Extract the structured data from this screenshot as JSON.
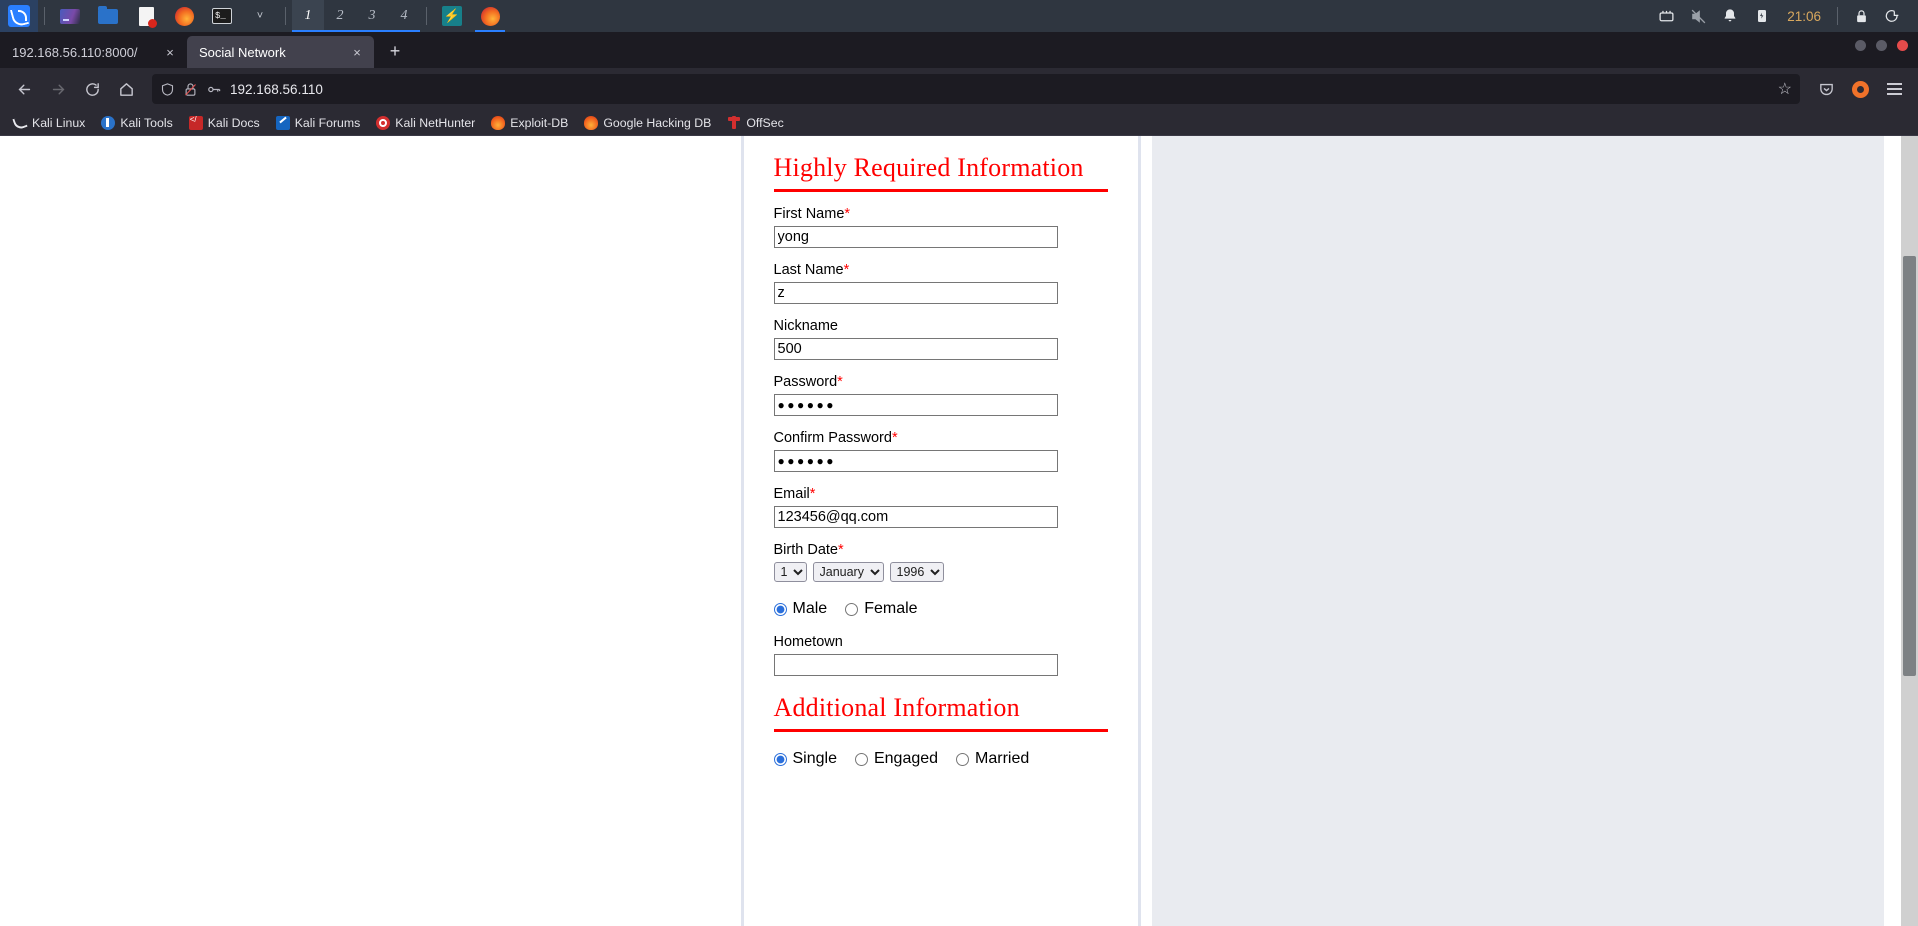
{
  "taskbar": {
    "apps": [
      {
        "name": "kali-menu-icon",
        "label": "Kali Linux Menu"
      },
      {
        "name": "workspace-switcher-icon",
        "label": "Workspace Switcher"
      },
      {
        "name": "file-manager-icon",
        "label": "Files"
      },
      {
        "name": "text-editor-icon",
        "label": "Text Editor"
      },
      {
        "name": "firefox-icon",
        "label": "Firefox"
      },
      {
        "name": "terminal-icon",
        "label": "Terminal"
      }
    ],
    "terminal_glyph": "$_",
    "dropdown_chevron": "˅",
    "workspaces": [
      "1",
      "2",
      "3",
      "4"
    ],
    "active_workspace": "1",
    "running": [
      {
        "name": "zap-icon",
        "glyph": "⚡"
      },
      {
        "name": "firefox-window-icon",
        "glyph": ""
      }
    ],
    "tray": {
      "network_icon": "network-icon",
      "volume_muted_icon": "volume-muted-icon",
      "notifications_icon": "bell-icon",
      "battery_icon": "battery-icon",
      "clock": "21:06",
      "lock_icon": "lock-icon",
      "logout_icon": "logout-icon"
    }
  },
  "browser": {
    "tabs": [
      {
        "title": "192.168.56.110:8000/",
        "active": false,
        "close": "×"
      },
      {
        "title": "Social Network",
        "active": true,
        "close": "×"
      }
    ],
    "new_tab_glyph": "+",
    "window_controls": [
      "minimize",
      "maximize",
      "close"
    ],
    "nav": {
      "back": "←",
      "forward": "→",
      "reload": "⟳",
      "home": "⌂"
    },
    "urlbar": {
      "shield_icon": "shield-icon",
      "insecure_lock_icon": "lock-crossed-icon",
      "key_icon": "key-icon",
      "url": "192.168.56.110",
      "bookmark_star": "☆"
    },
    "toolbar_right": {
      "pocket_icon": "pocket-icon",
      "extension_icon": "extension-orange-icon",
      "menu_icon": "hamburger-menu-icon"
    },
    "bookmarks": [
      {
        "label": "Kali Linux",
        "icon": "kali-dragon-icon"
      },
      {
        "label": "Kali Tools",
        "icon": "kali-tools-icon"
      },
      {
        "label": "Kali Docs",
        "icon": "kali-docs-icon"
      },
      {
        "label": "Kali Forums",
        "icon": "kali-forums-icon"
      },
      {
        "label": "Kali NetHunter",
        "icon": "kali-nethunter-icon"
      },
      {
        "label": "Exploit-DB",
        "icon": "exploit-db-icon"
      },
      {
        "label": "Google Hacking DB",
        "icon": "google-hacking-db-icon"
      },
      {
        "label": "OffSec",
        "icon": "offsec-icon"
      }
    ]
  },
  "page": {
    "sections": {
      "required_heading": "Highly Required Information",
      "additional_heading": "Additional Information"
    },
    "fields": {
      "first_name": {
        "label": "First Name",
        "required": "*",
        "value": "yong"
      },
      "last_name": {
        "label": "Last Name",
        "required": "*",
        "value": "z"
      },
      "nickname": {
        "label": "Nickname",
        "required": "",
        "value": "500"
      },
      "password": {
        "label": "Password",
        "required": "*",
        "value": "●●●●●●"
      },
      "confirm_password": {
        "label": "Confirm Password",
        "required": "*",
        "value": "●●●●●●"
      },
      "email": {
        "label": "Email",
        "required": "*",
        "value": "123456@qq.com"
      },
      "birth_date": {
        "label": "Birth Date",
        "required": "*",
        "day": "1",
        "month": "January",
        "year": "1996"
      },
      "hometown": {
        "label": "Hometown",
        "required": "",
        "value": ""
      }
    },
    "gender": {
      "options": [
        {
          "label": "Male",
          "selected": true
        },
        {
          "label": "Female",
          "selected": false
        }
      ]
    },
    "relationship": {
      "options": [
        {
          "label": "Single",
          "selected": true
        },
        {
          "label": "Engaged",
          "selected": false
        },
        {
          "label": "Married",
          "selected": false
        }
      ]
    }
  },
  "colors": {
    "heading_red": "#ff0000",
    "required_star": "#ff0000",
    "radio_accent": "#2a6fdb",
    "page_side": "#e9ebf0",
    "container_border": "#dfe3ee"
  }
}
